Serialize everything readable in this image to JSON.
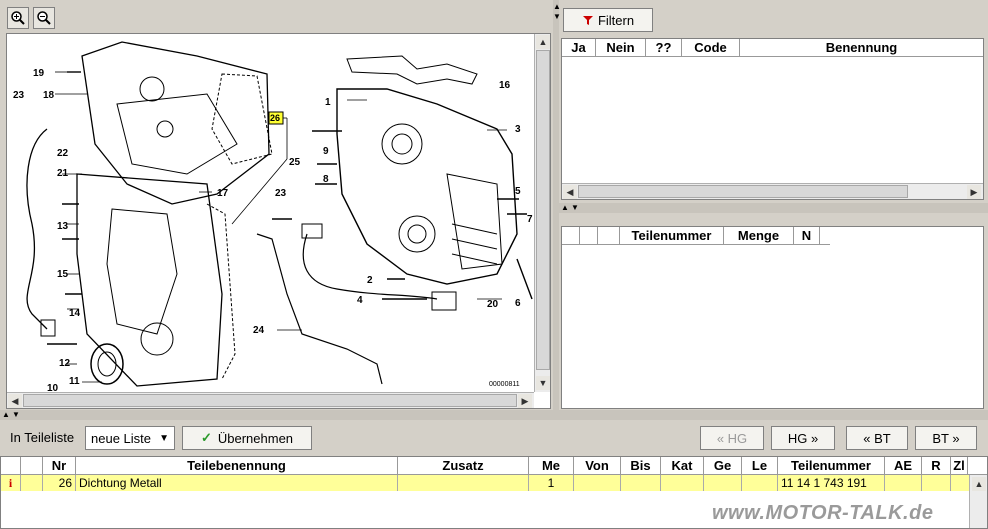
{
  "toolbar": {
    "zoom_in_icon": "zoom-in-icon",
    "zoom_out_icon": "zoom-out-icon"
  },
  "diagram": {
    "image_id": "00000811",
    "highlighted_part": "26",
    "callouts": [
      "19",
      "18",
      "23",
      "22",
      "21",
      "13",
      "15",
      "14",
      "12",
      "10",
      "11",
      "17",
      "25",
      "26",
      "23",
      "24",
      "1",
      "9",
      "8",
      "2",
      "4",
      "20",
      "6",
      "7",
      "5",
      "3",
      "16"
    ]
  },
  "filter": {
    "button_label": "Filtern",
    "columns": [
      "Ja",
      "Nein",
      "??",
      "Code",
      "Benennung"
    ]
  },
  "parts_table": {
    "columns": [
      "Teilenummer",
      "Menge",
      "N"
    ]
  },
  "list_bar": {
    "label": "In Teileliste",
    "select_value": "neue Liste",
    "apply_label": "Übernehmen",
    "prev_hg": "« HG",
    "next_hg": "HG »",
    "prev_bt": "« BT",
    "next_bt": "BT »"
  },
  "result_table": {
    "columns": [
      "Nr",
      "Teilebenennung",
      "Zusatz",
      "Me",
      "Von",
      "Bis",
      "Kat",
      "Ge",
      "Le",
      "Teilenummer",
      "AE",
      "R",
      "Zl"
    ],
    "rows": [
      {
        "info": "i",
        "nr": "26",
        "name": "Dichtung Metall",
        "zusatz": "",
        "me": "1",
        "von": "",
        "bis": "",
        "kat": "",
        "ge": "",
        "le": "",
        "teilenummer": "11 14 1 743 191",
        "ae": "",
        "r": "",
        "zl": ""
      }
    ]
  },
  "watermark": "www.MOTOR-TALK.de"
}
